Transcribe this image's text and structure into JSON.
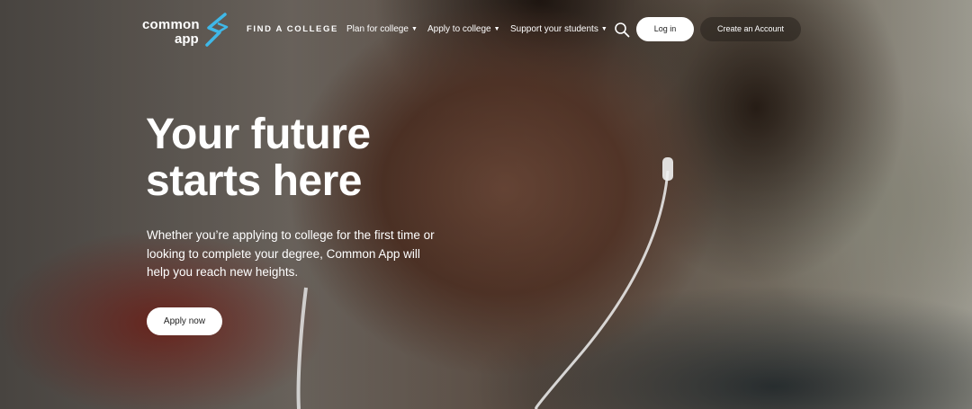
{
  "colors": {
    "accent_logo": "#3fb8e8",
    "button_light_bg": "#ffffff",
    "button_dark_bg": "#28221e",
    "text": "#ffffff"
  },
  "nav": {
    "logo": {
      "line1": "common",
      "line2": "app",
      "icon": "common-app-logo-mark"
    },
    "find_college": "FIND A COLLEGE",
    "plan_for_college": "Plan for college",
    "apply_to_college": "Apply to college",
    "support_students": "Support your students",
    "dropdown_icon": "caret-down-icon",
    "search_icon": "search-icon",
    "login": "Log in",
    "create_account": "Create an Account"
  },
  "hero": {
    "title_line1": "Your future",
    "title_line2": "starts here",
    "subtitle_line1": "Whether you’re applying to college for the first time or",
    "subtitle_line2": "looking to complete your degree, Common App will",
    "subtitle_line3": "help you reach new heights.",
    "cta": "Apply now"
  }
}
